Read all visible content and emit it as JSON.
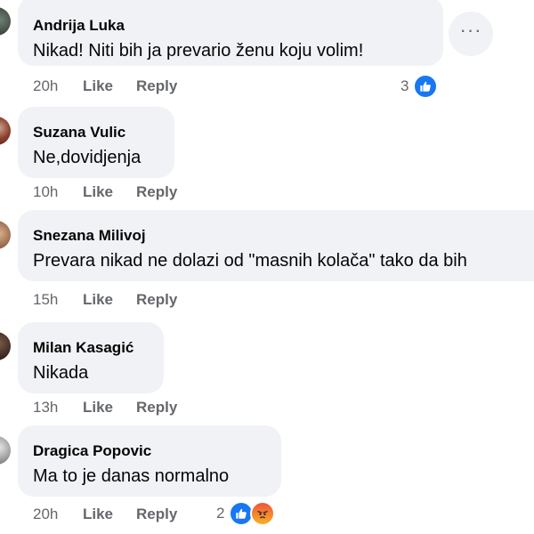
{
  "comments": [
    {
      "author": "Andrija Luka",
      "text": "Nikad! Niti bih ja prevario ženu koju volim!",
      "time": "20h",
      "like_label": "Like",
      "reply_label": "Reply",
      "reaction_count": "3",
      "reactions": [
        "like-reaction-icon"
      ]
    },
    {
      "author": "Suzana Vulic",
      "text": "Ne,dovidjenja",
      "time": "10h",
      "like_label": "Like",
      "reply_label": "Reply"
    },
    {
      "author": "Snezana Milivoj",
      "text": "Prevara nikad ne dolazi od \"masnih kolača\" tako da bih",
      "time": "15h",
      "like_label": "Like",
      "reply_label": "Reply"
    },
    {
      "author": "Milan Kasagić",
      "text": "Nikada",
      "time": "13h",
      "like_label": "Like",
      "reply_label": "Reply"
    },
    {
      "author": "Dragica Popovic",
      "text": "Ma to je danas normalno",
      "time": "20h",
      "like_label": "Like",
      "reply_label": "Reply",
      "reaction_count": "2",
      "reactions": [
        "like-reaction-icon",
        "angry-reaction-icon"
      ]
    }
  ],
  "colors": {
    "bubble": "#f0f2f5",
    "action_text": "#65676b",
    "like_blue": "#1877f2"
  }
}
